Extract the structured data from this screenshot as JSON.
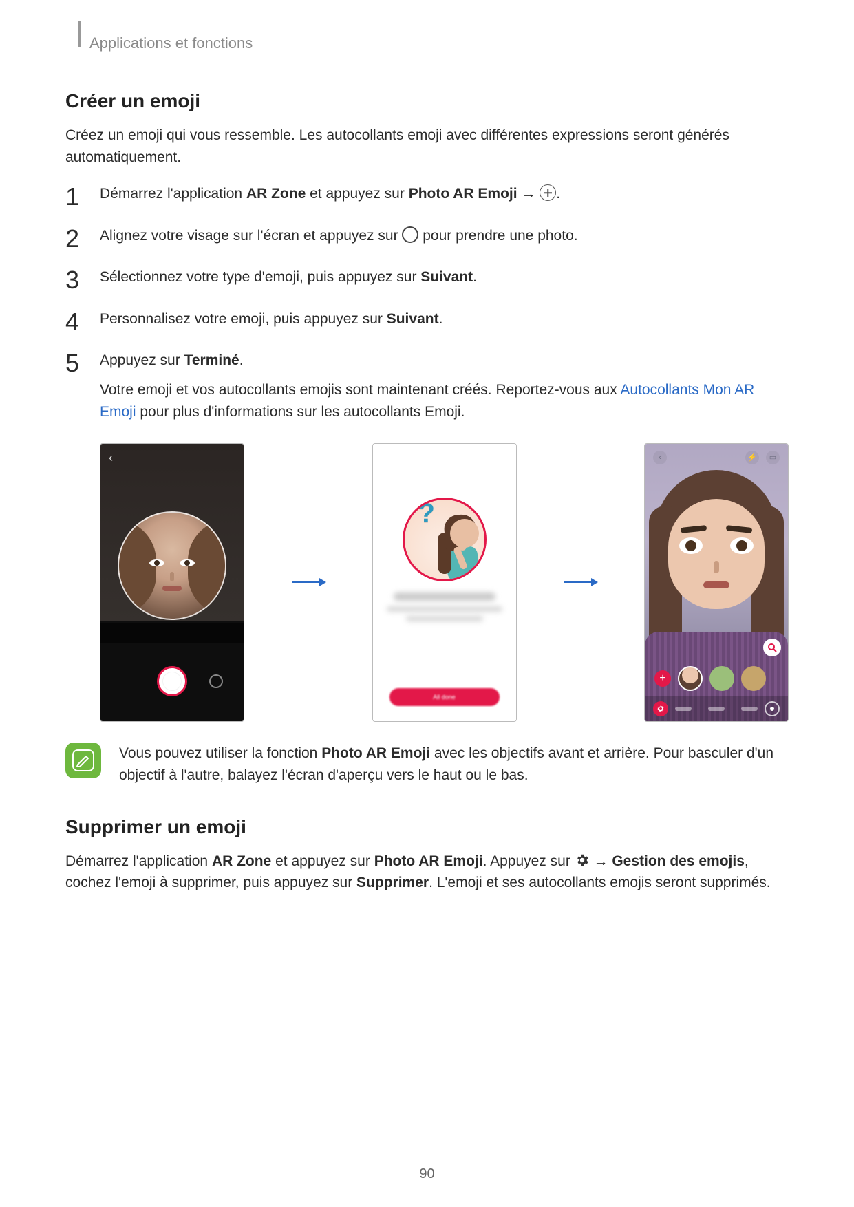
{
  "header": {
    "breadcrumb": "Applications et fonctions"
  },
  "section1": {
    "title": "Créer un emoji",
    "intro": "Créez un emoji qui vous ressemble. Les autocollants emoji avec différentes expressions seront générés automatiquement."
  },
  "steps": {
    "s1_a": "Démarrez l'application ",
    "s1_b": "AR Zone",
    "s1_c": " et appuyez sur ",
    "s1_d": "Photo AR Emoji",
    "s1_e": " → ",
    "s1_f": ".",
    "s2_a": "Alignez votre visage sur l'écran et appuyez sur ",
    "s2_b": " pour prendre une photo.",
    "s3_a": "Sélectionnez votre type d'emoji, puis appuyez sur ",
    "s3_b": "Suivant",
    "s3_c": ".",
    "s4_a": "Personnalisez votre emoji, puis appuyez sur ",
    "s4_b": "Suivant",
    "s4_c": ".",
    "s5_a": "Appuyez sur ",
    "s5_b": "Terminé",
    "s5_c": ".",
    "s5_detail_a": "Votre emoji et vos autocollants emojis sont maintenant créés. Reportez-vous aux ",
    "s5_detail_link": "Autocollants Mon AR Emoji",
    "s5_detail_b": " pour plus d'informations sur les autocollants Emoji."
  },
  "screens": {
    "s2_button": "All done"
  },
  "note": {
    "a": "Vous pouvez utiliser la fonction ",
    "b": "Photo AR Emoji",
    "c": " avec les objectifs avant et arrière. Pour basculer d'un objectif à l'autre, balayez l'écran d'aperçu vers le haut ou le bas."
  },
  "section2": {
    "title": "Supprimer un emoji",
    "p_a": "Démarrez l'application ",
    "p_b": "AR Zone",
    "p_c": " et appuyez sur ",
    "p_d": "Photo AR Emoji",
    "p_e": ". Appuyez sur ",
    "p_f": " → ",
    "p_g": "Gestion des emojis",
    "p_h": ", cochez l'emoji à supprimer, puis appuyez sur ",
    "p_i": "Supprimer",
    "p_j": ". L'emoji et ses autocollants emojis seront supprimés."
  },
  "pageNumber": "90"
}
